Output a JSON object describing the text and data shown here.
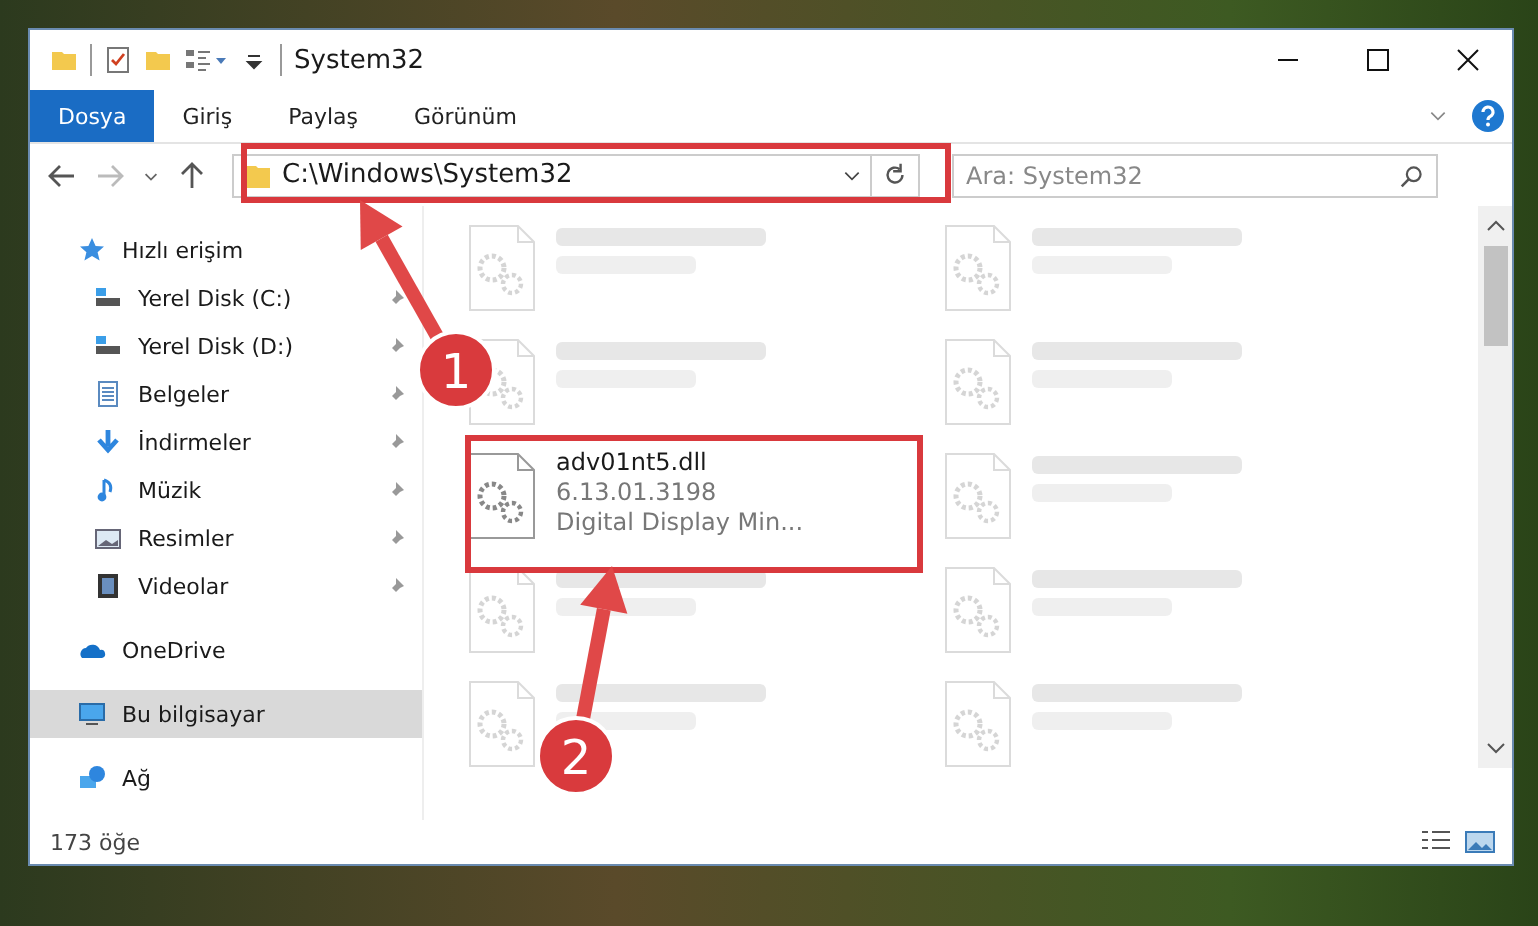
{
  "window": {
    "title": "System32"
  },
  "ribbon_tabs": [
    {
      "label": "Dosya",
      "selected": true
    },
    {
      "label": "Giriş",
      "selected": false
    },
    {
      "label": "Paylaş",
      "selected": false
    },
    {
      "label": "Görünüm",
      "selected": false
    }
  ],
  "address_bar": {
    "path": "C:\\Windows\\System32"
  },
  "search": {
    "placeholder": "Ara: System32"
  },
  "sidebar": {
    "items": [
      {
        "label": "Hızlı erişim",
        "kind": "star",
        "selected": false,
        "children": [
          {
            "label": "Yerel Disk (C:)",
            "kind": "drive",
            "pinned": true,
            "selected": false
          },
          {
            "label": "Yerel Disk (D:)",
            "kind": "drive",
            "pinned": true,
            "selected": false
          },
          {
            "label": "Belgeler",
            "kind": "document",
            "pinned": true,
            "selected": false
          },
          {
            "label": "İndirmeler",
            "kind": "download",
            "pinned": true,
            "selected": false
          },
          {
            "label": "Müzik",
            "kind": "music",
            "pinned": true,
            "selected": false
          },
          {
            "label": "Resimler",
            "kind": "picture",
            "pinned": true,
            "selected": false
          },
          {
            "label": "Videolar",
            "kind": "video",
            "pinned": true,
            "selected": false
          }
        ]
      },
      {
        "label": "OneDrive",
        "kind": "cloud",
        "selected": false
      },
      {
        "label": "Bu bilgisayar",
        "kind": "computer",
        "selected": true
      },
      {
        "label": "Ağ",
        "kind": "network",
        "selected": false
      }
    ]
  },
  "files": [
    {
      "blurred": true
    },
    {
      "blurred": true
    },
    {
      "blurred": true
    },
    {
      "blurred": true
    },
    {
      "name": "adv01nt5.dll",
      "line_2": "6.13.01.3198",
      "line_3": "Digital Display Min...",
      "blurred": false
    },
    {
      "blurred": true
    },
    {
      "blurred": true
    },
    {
      "blurred": true
    },
    {
      "blurred": true
    },
    {
      "blurred": true
    }
  ],
  "status_bar": {
    "count": "173 öğe"
  },
  "annotations": [
    {
      "number": "1"
    },
    {
      "number": "2"
    }
  ]
}
